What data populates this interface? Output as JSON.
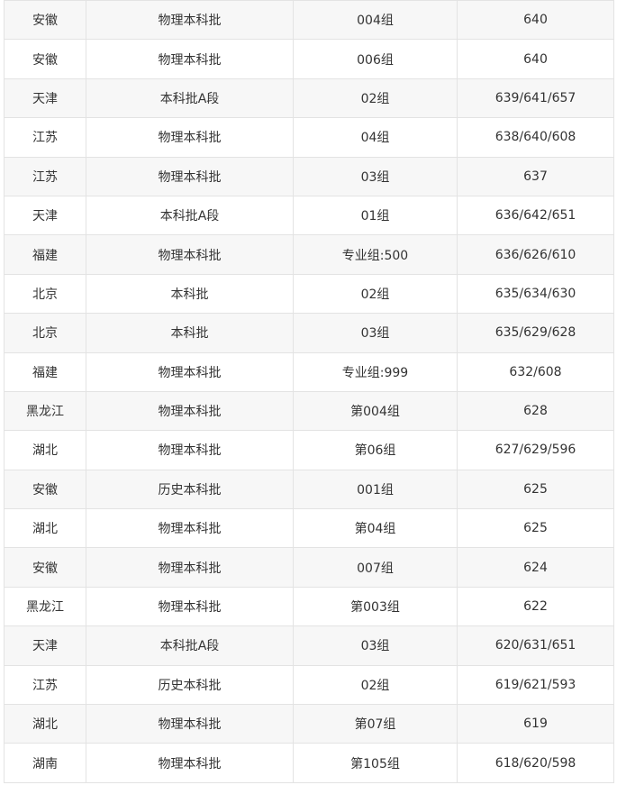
{
  "table": {
    "rows": [
      [
        "安徽",
        "物理本科批",
        "004组",
        "640"
      ],
      [
        "安徽",
        "物理本科批",
        "006组",
        "640"
      ],
      [
        "天津",
        "本科批A段",
        "02组",
        "639/641/657"
      ],
      [
        "江苏",
        "物理本科批",
        "04组",
        "638/640/608"
      ],
      [
        "江苏",
        "物理本科批",
        "03组",
        "637"
      ],
      [
        "天津",
        "本科批A段",
        "01组",
        "636/642/651"
      ],
      [
        "福建",
        "物理本科批",
        "专业组:500",
        "636/626/610"
      ],
      [
        "北京",
        "本科批",
        "02组",
        "635/634/630"
      ],
      [
        "北京",
        "本科批",
        "03组",
        "635/629/628"
      ],
      [
        "福建",
        "物理本科批",
        "专业组:999",
        "632/608"
      ],
      [
        "黑龙江",
        "物理本科批",
        "第004组",
        "628"
      ],
      [
        "湖北",
        "物理本科批",
        "第06组",
        "627/629/596"
      ],
      [
        "安徽",
        "历史本科批",
        "001组",
        "625"
      ],
      [
        "湖北",
        "物理本科批",
        "第04组",
        "625"
      ],
      [
        "安徽",
        "物理本科批",
        "007组",
        "624"
      ],
      [
        "黑龙江",
        "物理本科批",
        "第003组",
        "622"
      ],
      [
        "天津",
        "本科批A段",
        "03组",
        "620/631/651"
      ],
      [
        "江苏",
        "历史本科批",
        "02组",
        "619/621/593"
      ],
      [
        "湖北",
        "物理本科批",
        "第07组",
        "619"
      ],
      [
        "湖南",
        "物理本科批",
        "第105组",
        "618/620/598"
      ]
    ]
  }
}
